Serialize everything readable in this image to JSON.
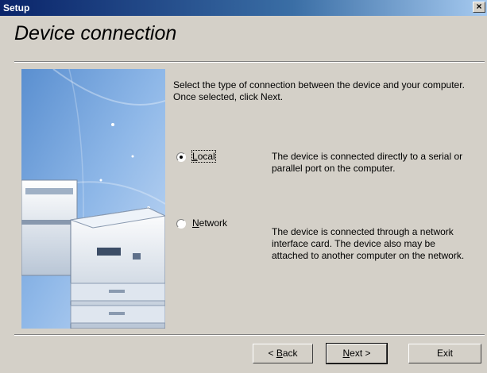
{
  "window": {
    "title": "Setup",
    "close_glyph": "×"
  },
  "page": {
    "heading": "Device connection"
  },
  "instructions": "Select the type of connection between the device and your computer. Once selected, click Next.",
  "options": [
    {
      "label": "Local",
      "mnemonic": "L",
      "rest": "ocal",
      "selected": true,
      "description": "The device is connected directly to a serial or parallel port on the computer."
    },
    {
      "label": "Network",
      "mnemonic": "N",
      "rest": "etwork",
      "selected": false,
      "description": "The device is connected through a network interface card. The device also may be attached to another computer on the network."
    }
  ],
  "buttons": {
    "back": {
      "prefix": "< ",
      "mnemonic": "B",
      "rest": "ack"
    },
    "next": {
      "mnemonic": "N",
      "rest": "ext >"
    },
    "exit": {
      "label": "Exit"
    }
  },
  "colors": {
    "title_start": "#0a246a",
    "title_end": "#a6caf0",
    "face": "#d4d0c8"
  }
}
